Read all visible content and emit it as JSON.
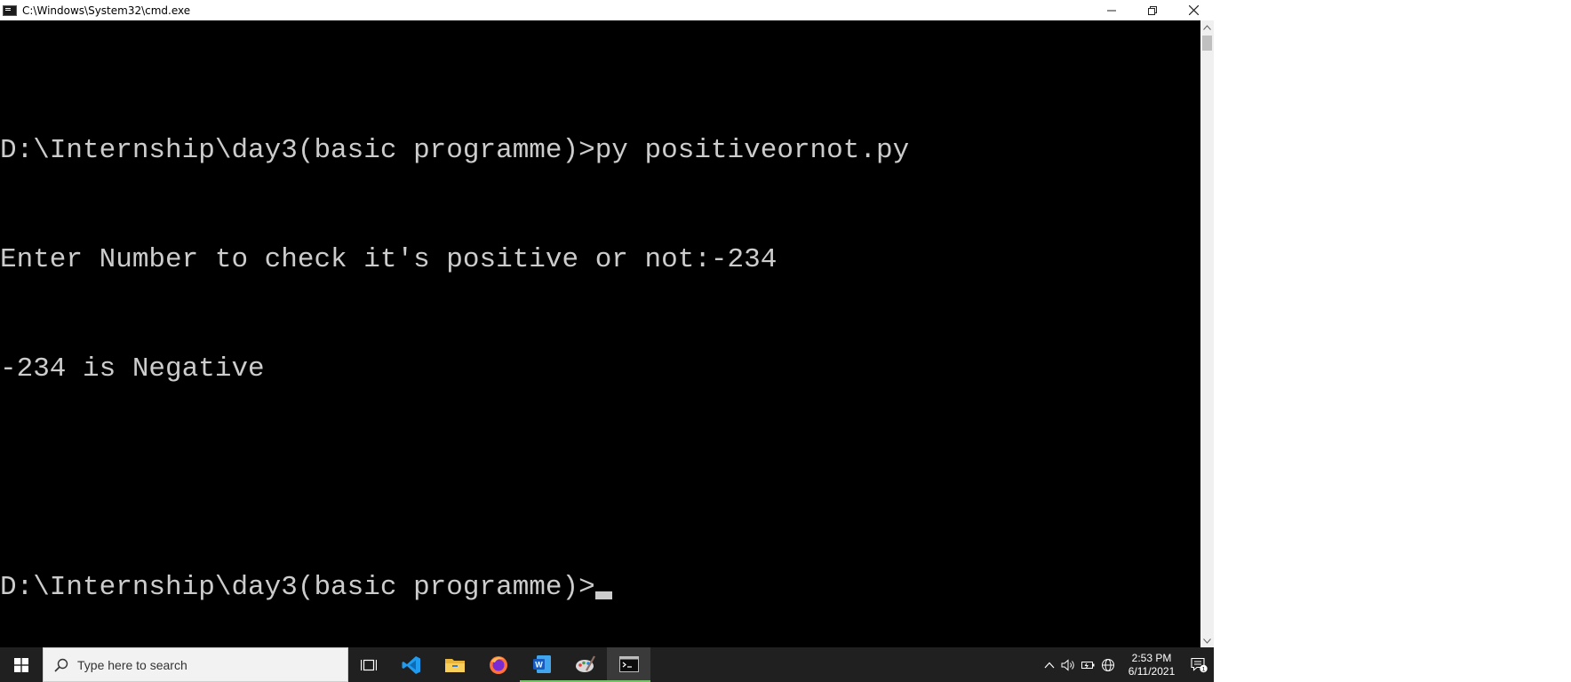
{
  "window": {
    "title": "C:\\Windows\\System32\\cmd.exe",
    "controls": {
      "minimize": "—",
      "restore": "❐",
      "close": "✕"
    }
  },
  "console": {
    "lines": [
      "",
      "D:\\Internship\\day3(basic programme)>py positiveornot.py",
      "Enter Number to check it's positive or not:-234",
      "-234 is Negative",
      "",
      "D:\\Internship\\day3(basic programme)>"
    ],
    "foreground": "#cccccc",
    "background": "#000000"
  },
  "taskbar": {
    "search_placeholder": "Type here to search",
    "apps": [
      {
        "name": "task-view-icon"
      },
      {
        "name": "vscode-icon"
      },
      {
        "name": "file-explorer-icon"
      },
      {
        "name": "firefox-icon"
      },
      {
        "name": "word-icon"
      },
      {
        "name": "paint-icon"
      },
      {
        "name": "cmd-icon"
      }
    ],
    "clock": {
      "time": "2:53 PM",
      "date": "6/11/2021"
    },
    "notification_count": "1",
    "accent_running": "#79c06b",
    "background": "#202020"
  }
}
